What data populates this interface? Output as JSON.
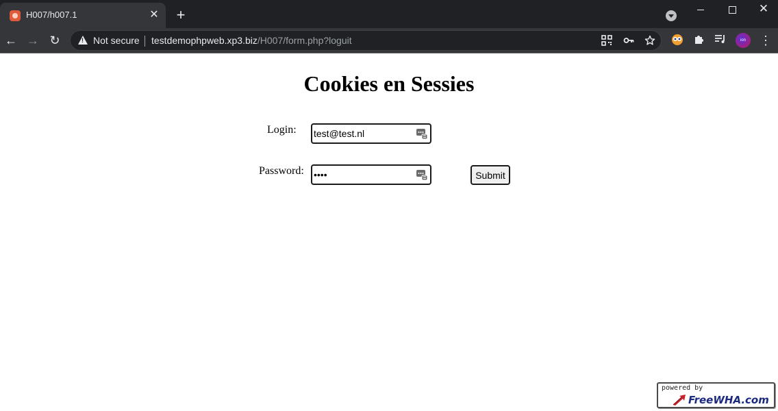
{
  "browser": {
    "tab": {
      "title": "H007/h007.1",
      "close_glyph": "✕"
    },
    "new_tab_glyph": "+",
    "window_close_glyph": "✕",
    "nav": {
      "back_glyph": "←",
      "forward_glyph": "→",
      "reload_glyph": "↻"
    },
    "omnibox": {
      "security_label": "Not secure",
      "url_host": "testdemophpweb.xp3.biz",
      "url_path": "/H007/form.php?loguit"
    },
    "omnibox_icons": [
      "qr-code-icon",
      "key-icon",
      "star-icon"
    ],
    "extension_icons": [
      "extension-owl-icon",
      "puzzle-icon",
      "reading-list-icon",
      "profile-avatar",
      "more-menu-icon"
    ],
    "profile_text": "ion",
    "more_glyph": "⋮"
  },
  "page": {
    "title": "Cookies en Sessies",
    "login_label": "Login:",
    "login_value": "test@test.nl",
    "password_label": "Password:",
    "password_value": "test",
    "submit_label": "Submit"
  },
  "footer_badge": {
    "powered_text": "powered by",
    "brand_text": "FreeWHA.com"
  },
  "colors": {
    "chrome_dark": "#202124",
    "chrome_toolbar": "#35363a",
    "brand_blue": "#1b2a80",
    "page_bg": "#ffffff"
  }
}
